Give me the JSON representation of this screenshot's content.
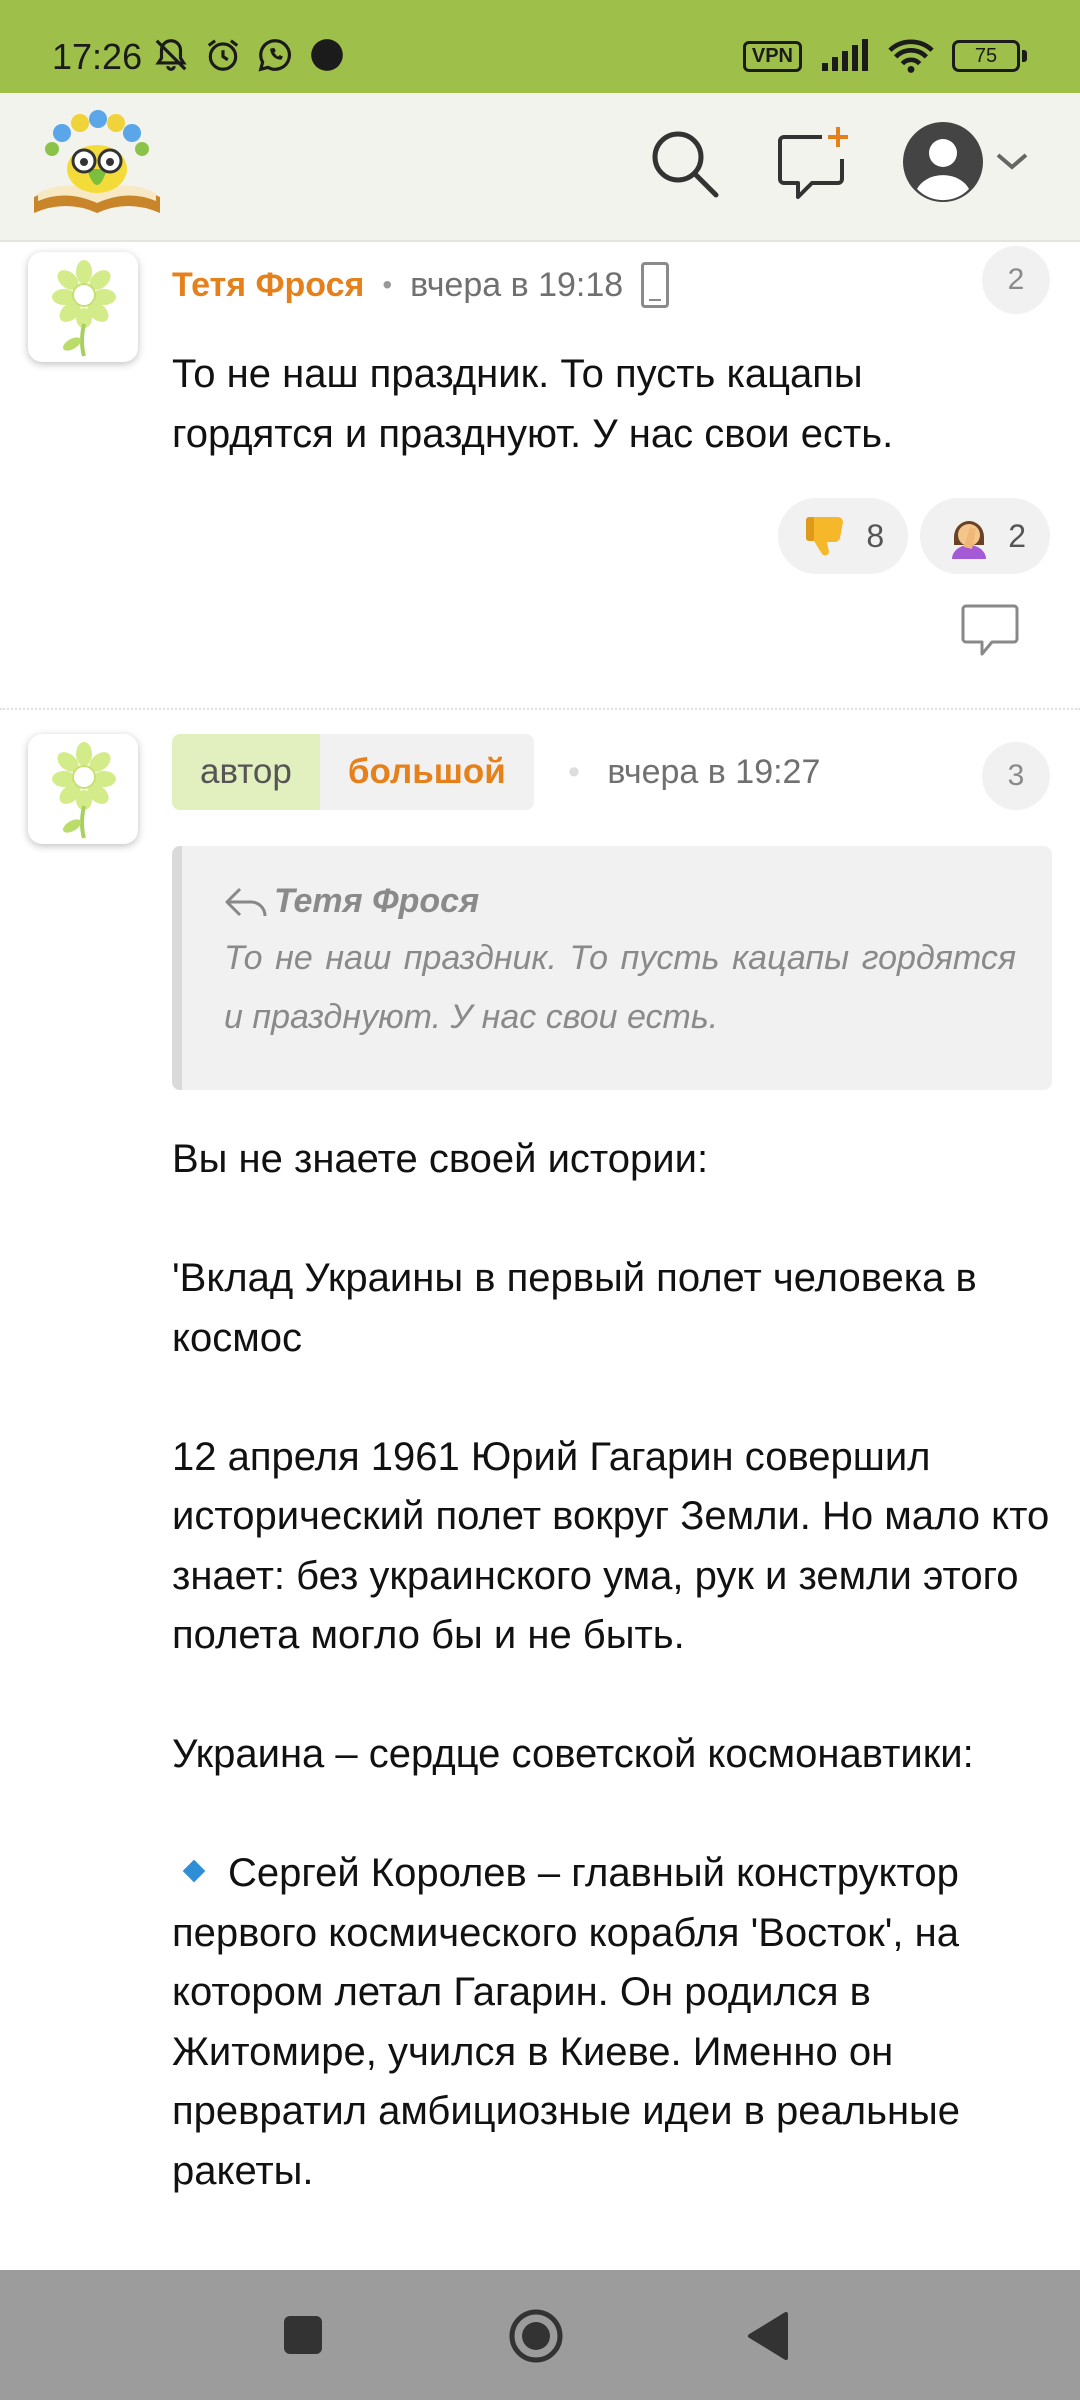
{
  "status_bar": {
    "time": "17:26",
    "vpn": "VPN",
    "battery": "75",
    "icons": [
      "mute-bell-icon",
      "alarm-icon",
      "whatsapp-icon",
      "dot-icon",
      "signal-icon",
      "wifi-icon"
    ]
  },
  "app_bar": {
    "logo": "app-logo",
    "actions": [
      "search-icon",
      "new-post-icon",
      "profile-avatar-icon",
      "chevron-down-icon"
    ]
  },
  "comments": [
    {
      "author": "Тетя Фрося",
      "separator": "•",
      "time": "вчера в 19:18",
      "number": "2",
      "text": "То не наш праздник. То пусть кацапы гордятся и празднуют. У нас свои есть.",
      "reactions": [
        {
          "icon": "thumbs-down-emoji",
          "count": "8"
        },
        {
          "icon": "facepalm-emoji",
          "count": "2"
        }
      ]
    },
    {
      "tag_author": "автор",
      "tag_name": "большой",
      "separator": "•",
      "time": "вчера в 19:27",
      "number": "3",
      "quote": {
        "author": "Тетя Фрося",
        "text": "То не наш праздник. То пусть кацапы гордятся и празднуют. У нас свои есть."
      },
      "paragraphs": [
        "Вы не знаете своей истории:",
        "'Вклад Украины в первый полет человека в космос",
        "12 апреля 1961 Юрий Гагарин совершил исторический полет вокруг Земли. Но мало кто знает: без украинского ума, рук и земли этого полета могло бы и не быть.",
        "Украина – сердце советской космонавтики:",
        "Сергей Королев – главный конструктор первого космического корабля 'Восток', на котором летал Гагарин. Он родился в Житомире, учился в Киеве. Именно он превратил амбициозные идеи в реальные ракеты."
      ]
    }
  ],
  "nav_bar": {
    "buttons": [
      "recents-square-icon",
      "home-circle-icon",
      "back-triangle-icon"
    ]
  }
}
